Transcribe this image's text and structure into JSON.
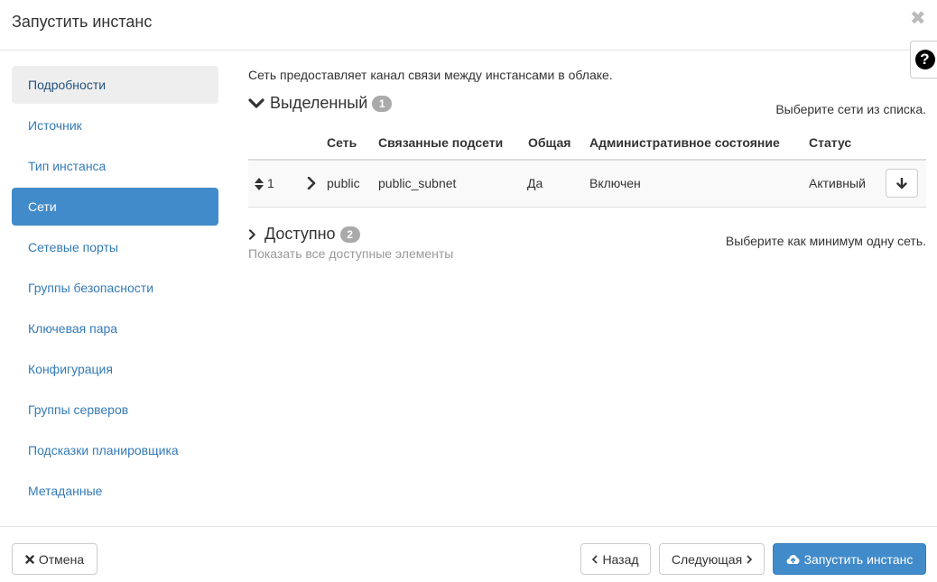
{
  "header": {
    "title": "Запустить инстанс",
    "close_icon": "close-icon",
    "help_label": "?"
  },
  "sidebar": {
    "items": [
      {
        "label": "Подробности",
        "state": "done"
      },
      {
        "label": "Источник",
        "state": "normal"
      },
      {
        "label": "Тип инстанса",
        "state": "normal"
      },
      {
        "label": "Сети",
        "state": "active"
      },
      {
        "label": "Сетевые порты",
        "state": "normal"
      },
      {
        "label": "Группы безопасности",
        "state": "normal"
      },
      {
        "label": "Ключевая пара",
        "state": "normal"
      },
      {
        "label": "Конфигурация",
        "state": "normal"
      },
      {
        "label": "Группы серверов",
        "state": "normal"
      },
      {
        "label": "Подсказки планировщика",
        "state": "normal"
      },
      {
        "label": "Метаданные",
        "state": "normal"
      }
    ]
  },
  "main": {
    "intro": "Сеть предоставляет канал связи между инстансами в облаке.",
    "allocated": {
      "title": "Выделенный",
      "count": "1",
      "hint": "Выберите сети из списка."
    },
    "table": {
      "headers": {
        "network": "Сеть",
        "subnets": "Связанные подсети",
        "shared": "Общая",
        "admin_state": "Административное состояние",
        "status": "Статус"
      },
      "rows": [
        {
          "index": "1",
          "network": "public",
          "subnets": "public_subnet",
          "shared": "Да",
          "admin_state": "Включен",
          "status": "Активный"
        }
      ]
    },
    "available": {
      "title": "Доступно",
      "count": "2",
      "hint": "Выберите как минимум одну сеть.",
      "show_all": "Показать все доступные элементы"
    }
  },
  "footer": {
    "cancel": "Отмена",
    "back": "Назад",
    "next": "Следующая",
    "launch": "Запустить инстанс"
  },
  "colors": {
    "accent": "#428bca",
    "link": "#337ab7",
    "badge": "#aaaaaa"
  }
}
